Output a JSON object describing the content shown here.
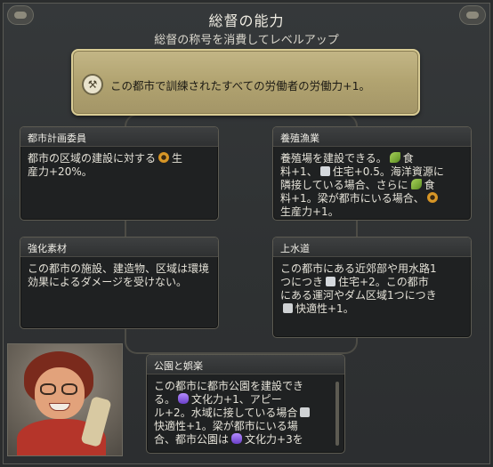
{
  "header": {
    "title": "総督の能力",
    "subtitle": "総督の称号を消費してレベルアップ"
  },
  "promotion": {
    "icon": "worker-icon",
    "text": "この都市で訓練されたすべての労働者の労働力+1。"
  },
  "cards": {
    "city_planning": {
      "title": "都市計画委員",
      "line1": "都市の区域の建設に対する",
      "line2": "生",
      "line3": "産力+20%。"
    },
    "aquaculture": {
      "title": "養殖漁業",
      "line1": "養殖場を建設できる。",
      "line1b": "食",
      "line2a": "料+1、",
      "line2b": "住宅+0.5。海洋資源に",
      "line3a": "隣接している場合、さらに",
      "line3b": "食",
      "line4a": "料+1。梁が都市にいる場合、",
      "line5": "生産力+1。"
    },
    "reinforced_materials": {
      "title": "強化素材",
      "body": "この都市の施設、建造物、区域は環境効果によるダメージを受けない。"
    },
    "water_works": {
      "title": "上水道",
      "line1": "この都市にある近郊部や用水路1",
      "line2a": "つにつき",
      "line2b": "住宅+2。この都市",
      "line3": "にある運河やダム区域1つにつき",
      "line4": "快適性+1。"
    },
    "parks_recreation": {
      "title": "公園と娯楽",
      "line1": "この都市に都市公園を建設でき",
      "line2a": "る。",
      "line2b": "文化力+1、アピー",
      "line3a": "ル+2。水域に接している場合",
      "line4": "快適性+1。梁が都市にいる場",
      "line5a": "合、都市公園は",
      "line5b": "文化力+3を"
    }
  },
  "icons": {
    "production": "production-icon",
    "food": "food-icon",
    "housing": "housing-icon",
    "amenity": "amenity-icon",
    "culture": "culture-icon"
  },
  "colors": {
    "promo_gold": "#b1a370",
    "card_bg": "#1f2122",
    "panel_bg": "#2f3233"
  }
}
